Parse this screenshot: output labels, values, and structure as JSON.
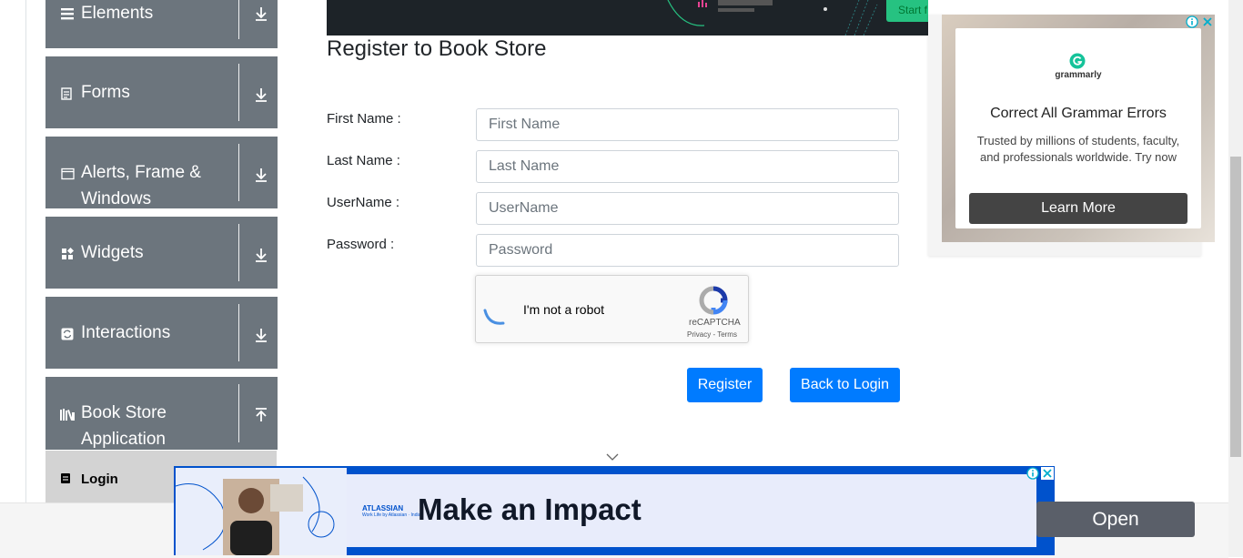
{
  "sidebar": {
    "groups": [
      {
        "title": "Elements",
        "icon": "hamburger-icon",
        "arrow": "down"
      },
      {
        "title": "Forms",
        "icon": "document-icon",
        "arrow": "down"
      },
      {
        "title": "Alerts, Frame & Windows",
        "icon": "window-icon",
        "arrow": "down"
      },
      {
        "title": "Widgets",
        "icon": "widgets-icon",
        "arrow": "down"
      },
      {
        "title": "Interactions",
        "icon": "interactions-icon",
        "arrow": "down"
      },
      {
        "title": "Book Store Application",
        "icon": "books-icon",
        "arrow": "up"
      }
    ],
    "active_item": {
      "label": "Login",
      "icon": "login-icon"
    }
  },
  "top_ad": {
    "cta_label": "Start f"
  },
  "form": {
    "heading": "Register to Book Store",
    "first_name": {
      "label": "First Name :",
      "placeholder": "First Name"
    },
    "last_name": {
      "label": "Last Name :",
      "placeholder": "Last Name"
    },
    "username": {
      "label": "UserName :",
      "placeholder": "UserName"
    },
    "password": {
      "label": "Password :",
      "placeholder": "Password"
    },
    "recaptcha": {
      "text": "I'm not a robot",
      "brand": "reCAPTCHA",
      "links": "Privacy - Terms"
    },
    "register_label": "Register",
    "back_label": "Back to Login"
  },
  "right_ad": {
    "brand": "grammarly",
    "headline": "Correct All Grammar Errors",
    "description": "Trusted by millions of students, faculty, and professionals worldwide. Try now",
    "cta_label": "Learn More"
  },
  "bottom_ad": {
    "brand": "ATLASSIAN",
    "brand_sub": "Work Life by Atlassian · India",
    "headline": "Make an Impact",
    "cta_label": "Open"
  },
  "colors": {
    "sidebar": "#6c757d",
    "primary": "#007bff",
    "bottom_ad": "#0052cc"
  }
}
